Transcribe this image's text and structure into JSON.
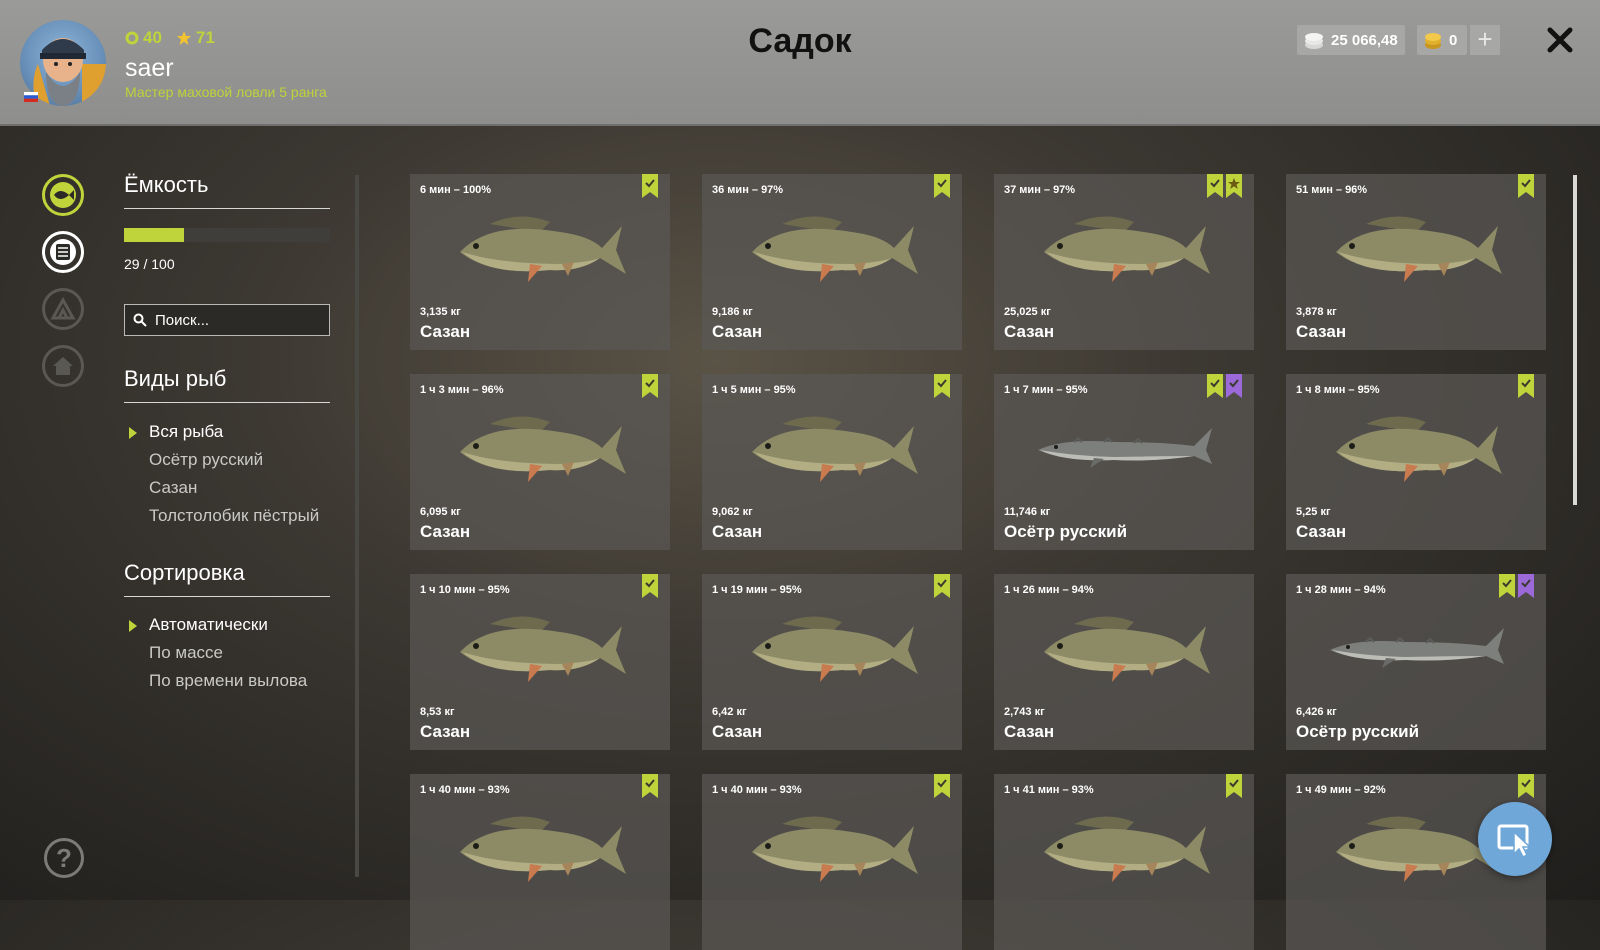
{
  "header": {
    "title": "Садок",
    "user": {
      "level": "40",
      "stars": "71",
      "name": "saer",
      "rank": "Мастер маховой ловли 5 ранга"
    },
    "silver": "25 066,48",
    "gold": "0",
    "plus_icon": "plus-icon",
    "close_icon": "close-icon"
  },
  "sidebar": {
    "icons": [
      "fish-icon",
      "keepnet-icon",
      "camp-icon",
      "home-icon"
    ],
    "help_label": "?"
  },
  "panel": {
    "capacity_title": "Ёмкость",
    "capacity_text": "29 / 100",
    "capacity_fraction": 0.29,
    "search_placeholder": "Поиск...",
    "species_title": "Виды рыб",
    "species": [
      "Вся рыба",
      "Осётр русский",
      "Сазан",
      "Толстолобик пёстрый"
    ],
    "sort_title": "Сортировка",
    "sort_options": [
      "Автоматически",
      "По массе",
      "По времени вылова"
    ]
  },
  "colors": {
    "accent": "#bfd33a",
    "purple": "#9b6ad8",
    "fab": "#6fa7d8"
  },
  "cards": [
    {
      "meta": "6 мин – 100%",
      "weight": "3,135 кг",
      "name": "Сазан",
      "kind": "carp",
      "badges": [
        "green"
      ]
    },
    {
      "meta": "36 мин – 97%",
      "weight": "9,186 кг",
      "name": "Сазан",
      "kind": "carp",
      "badges": [
        "green"
      ]
    },
    {
      "meta": "37 мин – 97%",
      "weight": "25,025 кг",
      "name": "Сазан",
      "kind": "carp",
      "badges": [
        "green",
        "star"
      ]
    },
    {
      "meta": "51 мин – 96%",
      "weight": "3,878 кг",
      "name": "Сазан",
      "kind": "carp",
      "badges": [
        "green"
      ]
    },
    {
      "meta": "1 ч 3 мин – 96%",
      "weight": "6,095 кг",
      "name": "Сазан",
      "kind": "carp",
      "badges": [
        "green"
      ]
    },
    {
      "meta": "1 ч 5 мин – 95%",
      "weight": "9,062 кг",
      "name": "Сазан",
      "kind": "carp",
      "badges": [
        "green"
      ]
    },
    {
      "meta": "1 ч 7 мин – 95%",
      "weight": "11,746 кг",
      "name": "Осётр русский",
      "kind": "sturgeon",
      "badges": [
        "green",
        "purple"
      ]
    },
    {
      "meta": "1 ч 8 мин – 95%",
      "weight": "5,25 кг",
      "name": "Сазан",
      "kind": "carp",
      "badges": [
        "green"
      ]
    },
    {
      "meta": "1 ч 10 мин – 95%",
      "weight": "8,53 кг",
      "name": "Сазан",
      "kind": "carp",
      "badges": [
        "green"
      ]
    },
    {
      "meta": "1 ч 19 мин – 95%",
      "weight": "6,42 кг",
      "name": "Сазан",
      "kind": "carp",
      "badges": [
        "green"
      ]
    },
    {
      "meta": "1 ч 26 мин – 94%",
      "weight": "2,743 кг",
      "name": "Сазан",
      "kind": "carp",
      "badges": []
    },
    {
      "meta": "1 ч 28 мин – 94%",
      "weight": "6,426 кг",
      "name": "Осётр русский",
      "kind": "sturgeon",
      "badges": [
        "green",
        "purple"
      ]
    },
    {
      "meta": "1 ч 40 мин – 93%",
      "weight": "",
      "name": "",
      "kind": "carp",
      "badges": [
        "green"
      ]
    },
    {
      "meta": "1 ч 40 мин – 93%",
      "weight": "",
      "name": "",
      "kind": "carp",
      "badges": [
        "green"
      ]
    },
    {
      "meta": "1 ч 41 мин – 93%",
      "weight": "",
      "name": "",
      "kind": "carp",
      "badges": [
        "green"
      ]
    },
    {
      "meta": "1 ч 49 мин – 92%",
      "weight": "",
      "name": "",
      "kind": "carp",
      "badges": [
        "green"
      ]
    }
  ],
  "fab_icon": "cursor-window-icon"
}
